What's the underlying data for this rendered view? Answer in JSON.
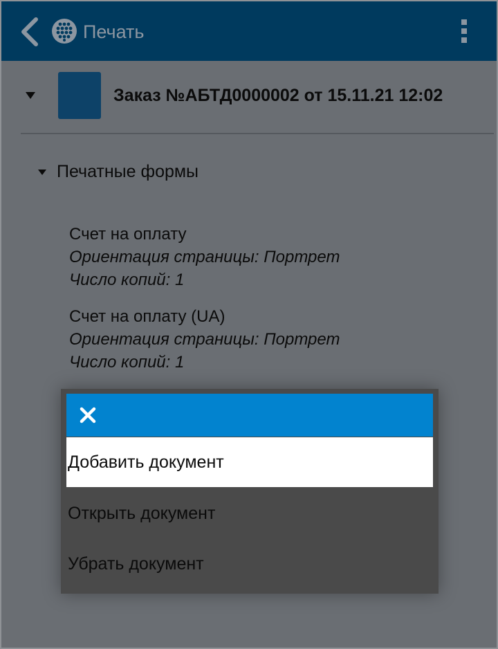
{
  "appbar": {
    "title": "Печать",
    "back_icon": "chevron-left-icon",
    "logo_icon": "app-logo-icon",
    "menu_icon": "more-vertical-icon"
  },
  "order": {
    "title": "Заказ №АБТД0000002 от 15.11.21 12:02",
    "expanded": true
  },
  "print_forms": {
    "title": "Печатные формы",
    "expanded": true,
    "items": [
      {
        "name": "Счет на оплату",
        "orientation": "Ориентация страницы: Портрет",
        "copies": "Число копий: 1"
      },
      {
        "name": "Счет на оплату (UA)",
        "orientation": "Ориентация страницы: Портрет",
        "copies": "Число копий: 1"
      }
    ]
  },
  "context_menu": {
    "close_icon": "close-icon",
    "items": [
      {
        "label": "Добавить документ",
        "selected": true
      },
      {
        "label": "Открыть документ",
        "selected": false
      },
      {
        "label": "Убрать документ",
        "selected": false
      }
    ]
  },
  "colors": {
    "appbar_bg": "#003a5e",
    "appbar_text": "#8c96a1",
    "dim_bg": "#6a6e73",
    "menu_header": "#0283cf",
    "menu_bg": "#4a4a4a",
    "thumb": "#0d4268"
  }
}
